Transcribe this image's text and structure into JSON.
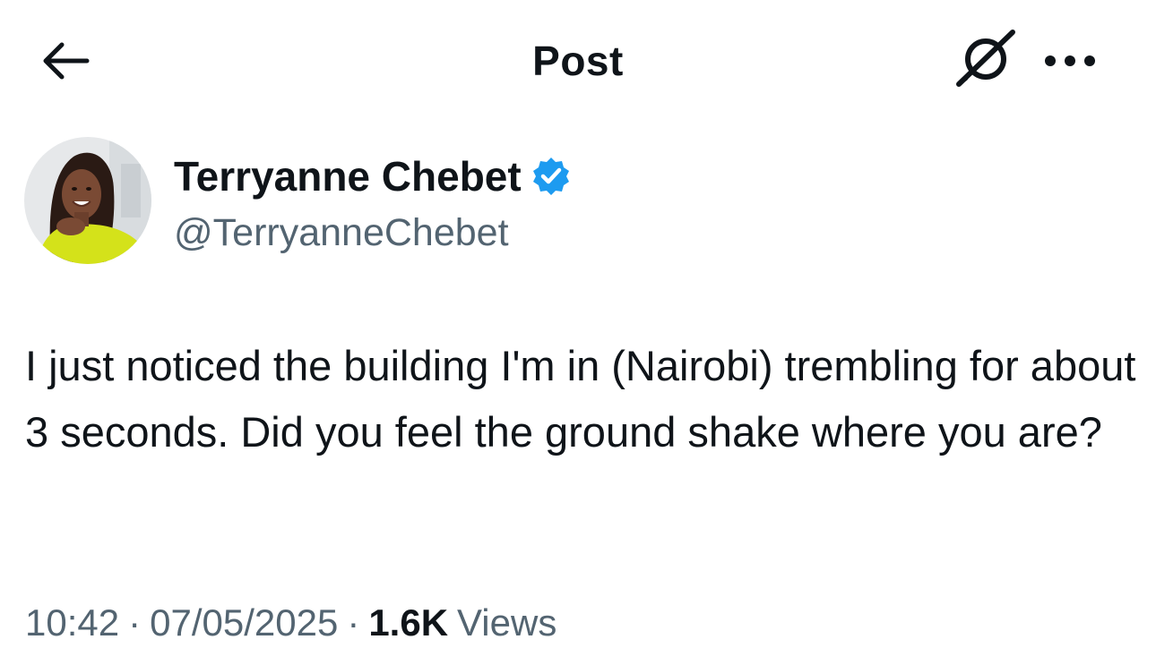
{
  "header": {
    "title": "Post",
    "back_icon": "arrow-left-icon",
    "grok_icon": "grok-icon",
    "more_icon": "more-horizontal-icon"
  },
  "author": {
    "display_name": "Terryanne Chebet",
    "handle": "@TerryanneChebet",
    "verified": true,
    "verified_color": "#1d9bf0"
  },
  "post": {
    "text": "I just noticed the building I'm in (Nairobi) trembling for about 3 seconds. Did you feel the ground shake where you are?",
    "time": "10:42",
    "date": "07/05/2025",
    "separator": "·",
    "views_count": "1.6K",
    "views_label": "Views"
  },
  "colors": {
    "text_primary": "#0f1419",
    "text_secondary": "#536471",
    "background": "#ffffff",
    "accent": "#1d9bf0"
  }
}
